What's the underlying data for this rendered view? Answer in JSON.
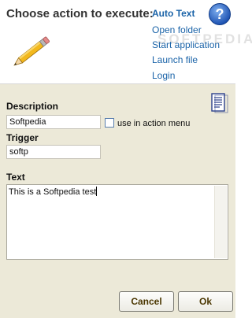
{
  "header": {
    "title": "Choose action to execute:",
    "actions": [
      {
        "label": "Auto Text",
        "selected": true
      },
      {
        "label": "Open folder",
        "selected": false
      },
      {
        "label": "Start application",
        "selected": false
      },
      {
        "label": "Launch file",
        "selected": false
      },
      {
        "label": "Login",
        "selected": false
      }
    ],
    "watermark": "SOFTPEDIA"
  },
  "form": {
    "description_label": "Description",
    "description_value": "Softpedia",
    "use_in_action_menu_label": "use in action menu",
    "use_in_action_menu_checked": false,
    "trigger_label": "Trigger",
    "trigger_value": "softp",
    "text_label": "Text",
    "text_value": "This is a Softpedia test"
  },
  "buttons": {
    "cancel": "Cancel",
    "ok": "Ok"
  },
  "colors": {
    "link": "#1a63a8",
    "panel": "#ece9d8",
    "button_text": "#4a3600"
  }
}
